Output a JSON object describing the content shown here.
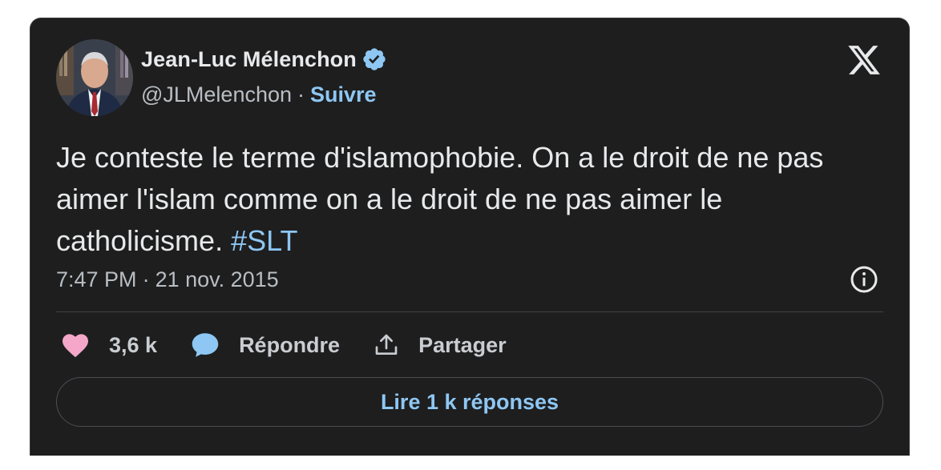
{
  "author": {
    "name": "Jean-Luc Mélenchon",
    "handle": "@JLMelenchon",
    "separator": "·",
    "follow_label": "Suivre",
    "verified": true,
    "verified_color": "#8ec7f3"
  },
  "tweet": {
    "text": "Je conteste le terme d'islamophobie. On a le droit de ne pas aimer l'islam comme on a le droit de ne pas aimer le catholicisme.",
    "hashtag": "#SLT",
    "time": "7:47 PM",
    "date_separator": "·",
    "date": "21 nov. 2015"
  },
  "actions": {
    "likes_count": "3,6 k",
    "reply_label": "Répondre",
    "share_label": "Partager"
  },
  "replies_button_label": "Lire 1 k réponses",
  "colors": {
    "background": "#1e1e1f",
    "accent": "#8ec7f3",
    "heart": "#f4a7c8",
    "text": "#e7e9ea",
    "muted": "#b9bec3"
  },
  "icons": {
    "close": "x-logo-icon",
    "verified": "verified-badge-icon",
    "info": "info-icon",
    "like": "heart-icon",
    "reply": "speech-bubble-icon",
    "share": "share-upload-icon"
  }
}
